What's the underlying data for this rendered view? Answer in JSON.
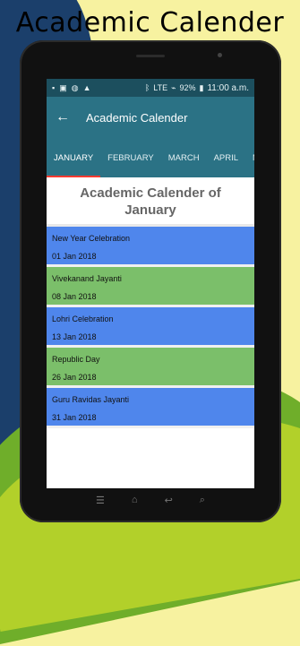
{
  "promo": {
    "title": "Academic Calender"
  },
  "status_bar": {
    "battery": "92%",
    "time": "11:00 a.m.",
    "signal": "LTE",
    "left_icons": [
      "notification-icon",
      "image-icon",
      "warning-icon"
    ]
  },
  "app_bar": {
    "title": "Academic Calender"
  },
  "tabs": [
    {
      "label": "JANUARY",
      "active": true
    },
    {
      "label": "FEBRUARY",
      "active": false
    },
    {
      "label": "MARCH",
      "active": false
    },
    {
      "label": "APRIL",
      "active": false
    },
    {
      "label": "MA",
      "active": false
    }
  ],
  "section": {
    "title": "Academic Calender of January"
  },
  "events": [
    {
      "name": "New Year Celebration",
      "date": "01 Jan 2018",
      "color": "#4f86ec"
    },
    {
      "name": "Vivekanand Jayanti",
      "date": "08 Jan 2018",
      "color": "#7bbf6a"
    },
    {
      "name": "Lohri Celebration",
      "date": "13 Jan 2018",
      "color": "#4f86ec"
    },
    {
      "name": "Republic Day",
      "date": "26 Jan 2018",
      "color": "#7bbf6a"
    },
    {
      "name": "Guru Ravidas Jayanti",
      "date": "31 Jan 2018",
      "color": "#4f86ec"
    }
  ],
  "colors": {
    "appbar": "#2b7285",
    "statusbar": "#1c4f5e",
    "tab_indicator": "#ff3b30"
  }
}
